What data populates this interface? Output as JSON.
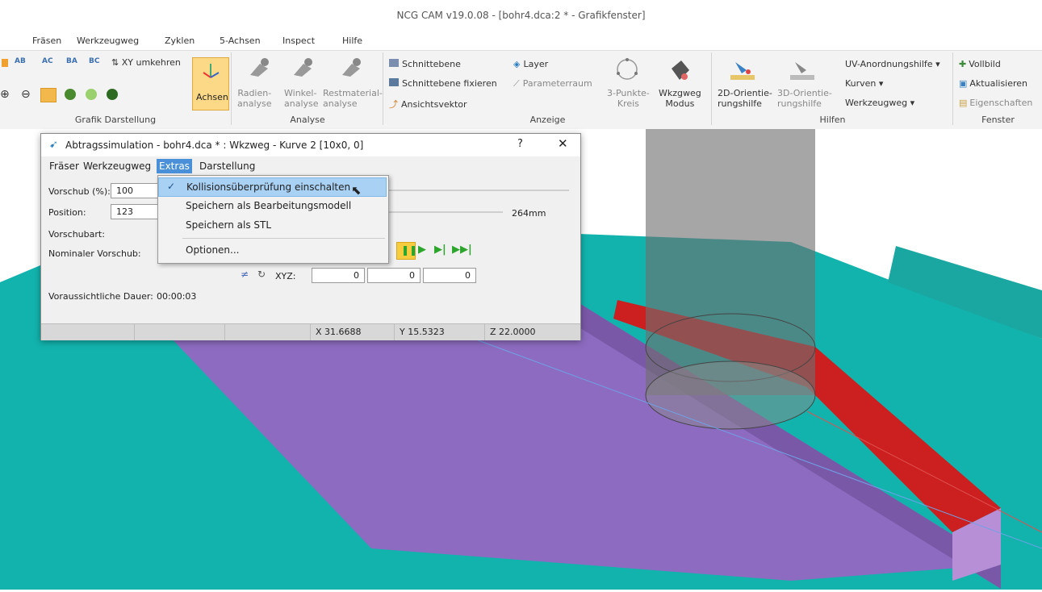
{
  "window": {
    "title": "NCG CAM v19.0.08 - [bohr4.dca:2 * - Grafikfenster]"
  },
  "menu": {
    "items": [
      "Fräsen",
      "Werkzeugweg",
      "Zyklen",
      "5-Achsen",
      "Inspect",
      "Hilfe"
    ]
  },
  "ribbon": {
    "grafik": {
      "label": "Grafik Darstellung",
      "view_buttons": [
        "AB",
        "AC",
        "BA",
        "BC"
      ],
      "xy_swap": "XY umkehren",
      "axes": "Achsen"
    },
    "analyse": {
      "label": "Analyse",
      "radien": "Radien-\nanalyse",
      "winkel": "Winkel-\nanalyse",
      "rest": "Restmaterial-\nanalyse"
    },
    "anzeige": {
      "label": "Anzeige",
      "schnittebene": "Schnittebene",
      "schnittebene_fix": "Schnittebene fixieren",
      "ansichtsvektor": "Ansichtsvektor",
      "layer": "Layer",
      "parameterraum": "Parameterraum",
      "kreis": "3-Punkte-\nKreis",
      "wkzweg": "Wkzgweg\nModus"
    },
    "hilfen": {
      "label": "Hilfen",
      "orient2d": "2D-Orientie-\nrungshilfe",
      "orient3d": "3D-Orientie-\nrungshilfe",
      "uv": "UV-Anordnungshilfe",
      "kurven": "Kurven",
      "werkzeugweg": "Werkzeugweg"
    },
    "fenster": {
      "label": "Fenster",
      "vollbild": "Vollbild",
      "aktualisieren": "Aktualisieren",
      "eigenschaften": "Eigenschaften"
    }
  },
  "dialog": {
    "title": "Abtragssimulation - bohr4.dca * : Wkzweg - Kurve 2 [10x0, 0]",
    "help": "?",
    "close": "✕",
    "menu": [
      "Fräser",
      "Werkzeugweg",
      "Extras",
      "Darstellung"
    ],
    "vorschub_label": "Vorschub (%):",
    "vorschub_value": "100",
    "position_label": "Position:",
    "position_value": "123",
    "position_total": "264mm",
    "vorschubart_label": "Vorschubart:",
    "nominal_label": "Nominaler Vorschub:",
    "xyz_label": "XYZ:",
    "xyz": [
      "0",
      "0",
      "0"
    ],
    "dauer_label": "Voraussichtliche Dauer:",
    "dauer_value": "00:00:03",
    "status": {
      "x": "X 31.6688",
      "y": "Y 15.5323",
      "z": "Z 22.0000"
    }
  },
  "extras_menu": {
    "items": [
      {
        "label": "Kollisionsüberprüfung einschalten",
        "checked": true
      },
      {
        "label": "Speichern als Bearbeitungsmodell",
        "checked": false
      },
      {
        "label": "Speichern als STL",
        "checked": false
      },
      {
        "label": "Optionen...",
        "checked": false
      }
    ]
  },
  "colors": {
    "teal": "#12b3ad",
    "purple": "#8d6bc0",
    "red": "#cc1f1f",
    "highlight": "#a9d1f4",
    "axes_orange": "#f2b84b"
  }
}
